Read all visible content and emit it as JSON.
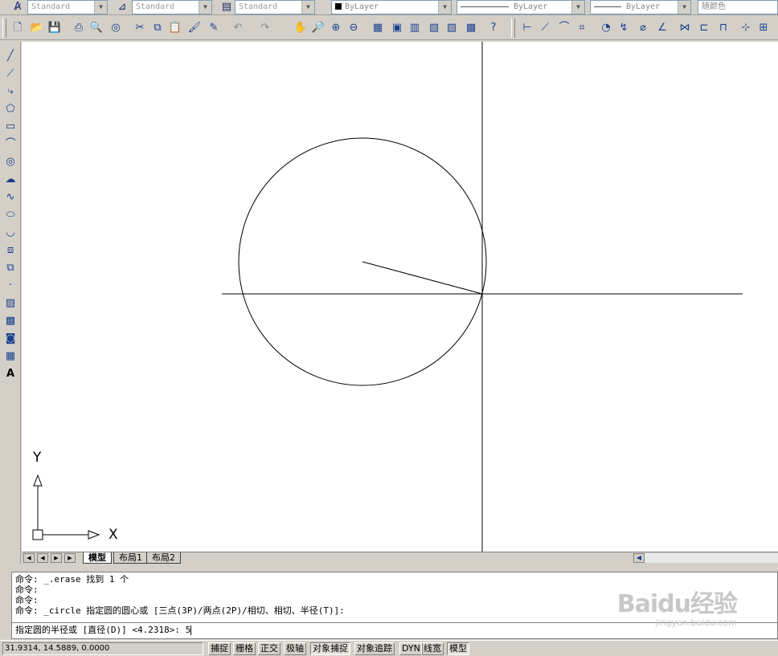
{
  "style_bar": {
    "text_style": "Standard",
    "dim_style": "Standard",
    "table_style": "Standard",
    "layer_color": "ByLayer",
    "linetype": "ByLayer",
    "lineweight": "ByLayer",
    "plot_style": "随颜色"
  },
  "layout_tabs": [
    "模型",
    "布局1",
    "布局2"
  ],
  "active_tab": "模型",
  "command_history": [
    "命令: _.erase 找到 1 个",
    "命令:",
    "命令:",
    "命令: _circle 指定圆的圆心或 [三点(3P)/两点(2P)/相切、相切、半径(T)]:"
  ],
  "command_prompt": "指定圆的半径或 [直径(D)] <4.2318>: ",
  "command_input": "5",
  "watermark": {
    "brand": "Baidu经验",
    "url": "jingyan.baidu.com"
  },
  "ucs": {
    "x_label": "X",
    "y_label": "Y"
  },
  "status": {
    "coordinates": "31.9314, 14.5889, 0.0000",
    "buttons": [
      {
        "label": "捕捉",
        "on": false
      },
      {
        "label": "栅格",
        "on": false
      },
      {
        "label": "正交",
        "on": false
      },
      {
        "label": "极轴",
        "on": false
      },
      {
        "label": "对象捕捉",
        "on": true
      },
      {
        "label": "对象追踪",
        "on": false
      },
      {
        "label": "DYN",
        "on": false
      },
      {
        "label": "线宽",
        "on": false
      },
      {
        "label": "模型",
        "on": true
      }
    ]
  },
  "colors": {
    "ui_gray": "#d4d0c8",
    "canvas": "#ffffff",
    "icon_blue": "#1b3f8f"
  }
}
